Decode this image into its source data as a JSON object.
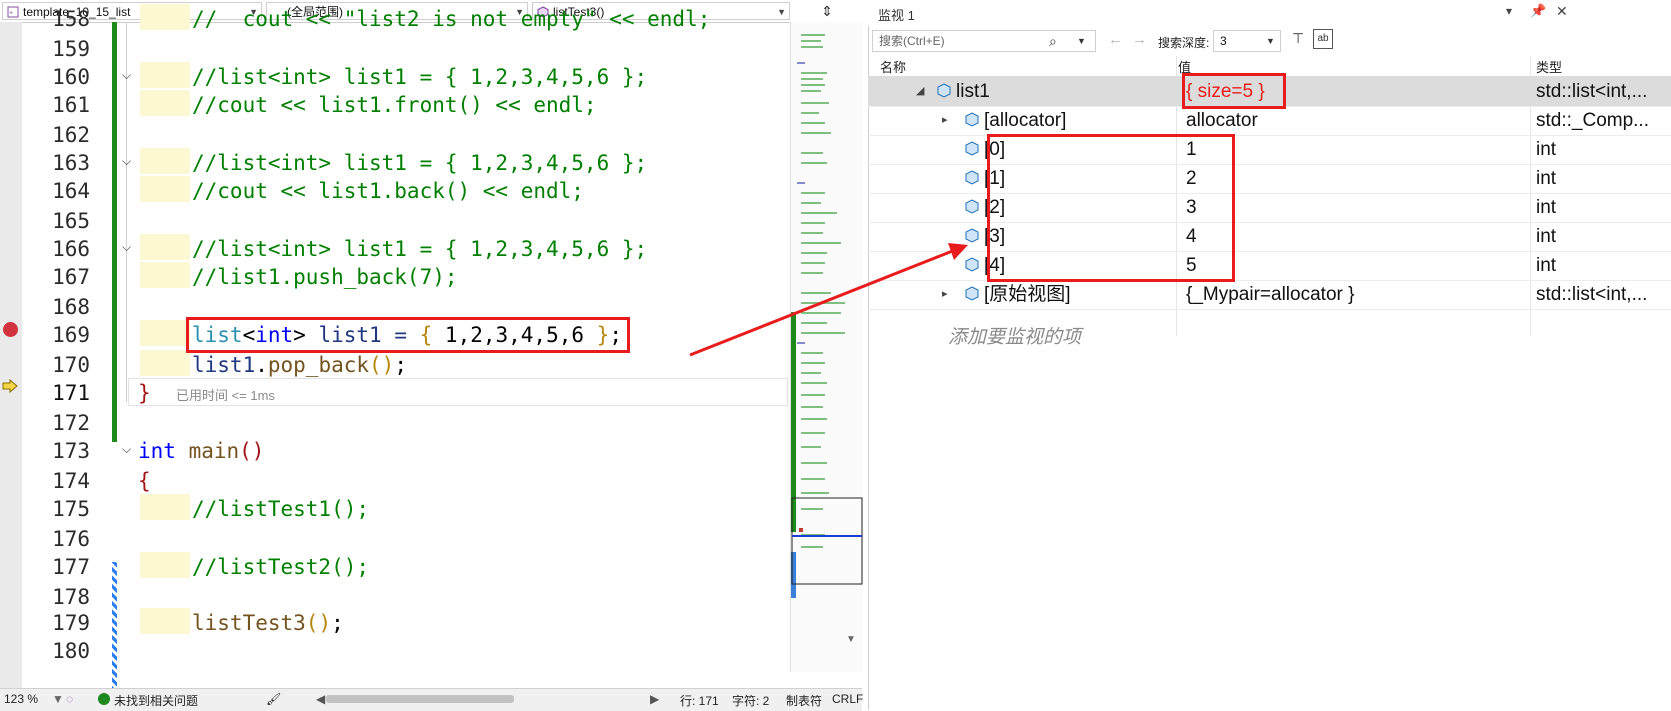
{
  "nav": {
    "file": "template_10_15_list",
    "scope": "(全局范围)",
    "function": "listTest3()"
  },
  "editor": {
    "lines": [
      {
        "num": "158",
        "text": "//  cout << \"list2 is not empty\" << endl;"
      },
      {
        "num": "159"
      },
      {
        "num": "160",
        "text": "//list<int> list1 = { 1,2,3,4,5,6 };"
      },
      {
        "num": "161",
        "text": "//cout << list1.front() << endl;"
      },
      {
        "num": "162"
      },
      {
        "num": "163",
        "text": "//list<int> list1 = { 1,2,3,4,5,6 };"
      },
      {
        "num": "164",
        "text": "//cout << list1.back() << endl;"
      },
      {
        "num": "165"
      },
      {
        "num": "166",
        "text": "//list<int> list1 = { 1,2,3,4,5,6 };"
      },
      {
        "num": "167",
        "text": "//list1.push_back(7);"
      },
      {
        "num": "168"
      },
      {
        "num": "169"
      },
      {
        "num": "170"
      },
      {
        "num": "171"
      },
      {
        "num": "172"
      },
      {
        "num": "173"
      },
      {
        "num": "174"
      },
      {
        "num": "175",
        "text": "//listTest1();"
      },
      {
        "num": "176"
      },
      {
        "num": "177",
        "text": "//listTest2();"
      },
      {
        "num": "178"
      },
      {
        "num": "179"
      },
      {
        "num": "180"
      }
    ],
    "code169": {
      "t1": "list",
      "t2": "<",
      "t3": "int",
      "t4": ">",
      "t5": " list1 = ",
      "t6": "{",
      "t7": " 1,2,3,4,5,6 ",
      "t8": "}",
      "t9": ";"
    },
    "code170": {
      "a": "list1",
      "b": ".",
      "c": "pop_back",
      "d": "()",
      "e": ";"
    },
    "code171": {
      "brace": "}",
      "hint": "已用时间 <= 1ms"
    },
    "code173": {
      "kw": "int",
      "fn": " main",
      "p": "()"
    },
    "code174": {
      "brace": "{"
    },
    "code179": {
      "fn": "listTest3",
      "p": "()",
      "e": ";"
    }
  },
  "status": {
    "zoom": "123 %",
    "issues": "未找到相关问题",
    "line": "行: 171",
    "char": "字符: 2",
    "tabs": "制表符",
    "eol": "CRLF"
  },
  "watch": {
    "title": "监视 1",
    "search_placeholder": "搜索(Ctrl+E)",
    "depth_label": "搜索深度:",
    "depth_value": "3",
    "col_name": "名称",
    "col_value": "值",
    "col_type": "类型",
    "rows": [
      {
        "name": "list1",
        "value": "{ size=5 }",
        "type": "std::list<int,..."
      },
      {
        "name": "[allocator]",
        "value": "allocator",
        "type": "std::_Comp..."
      },
      {
        "name": "[0]",
        "value": "1",
        "type": "int"
      },
      {
        "name": "[1]",
        "value": "2",
        "type": "int"
      },
      {
        "name": "[2]",
        "value": "3",
        "type": "int"
      },
      {
        "name": "[3]",
        "value": "4",
        "type": "int"
      },
      {
        "name": "[4]",
        "value": "5",
        "type": "int"
      },
      {
        "name": "[原始视图]",
        "value": "{_Mypair=allocator }",
        "type": "std::list<int,..."
      }
    ],
    "add_item": "添加要监视的项"
  },
  "colors": {
    "comment": "#008000",
    "keyword": "#0000ff",
    "type": "#2b91af",
    "annotation": "#e81c1c",
    "change_bar": "#1e8a1e"
  }
}
